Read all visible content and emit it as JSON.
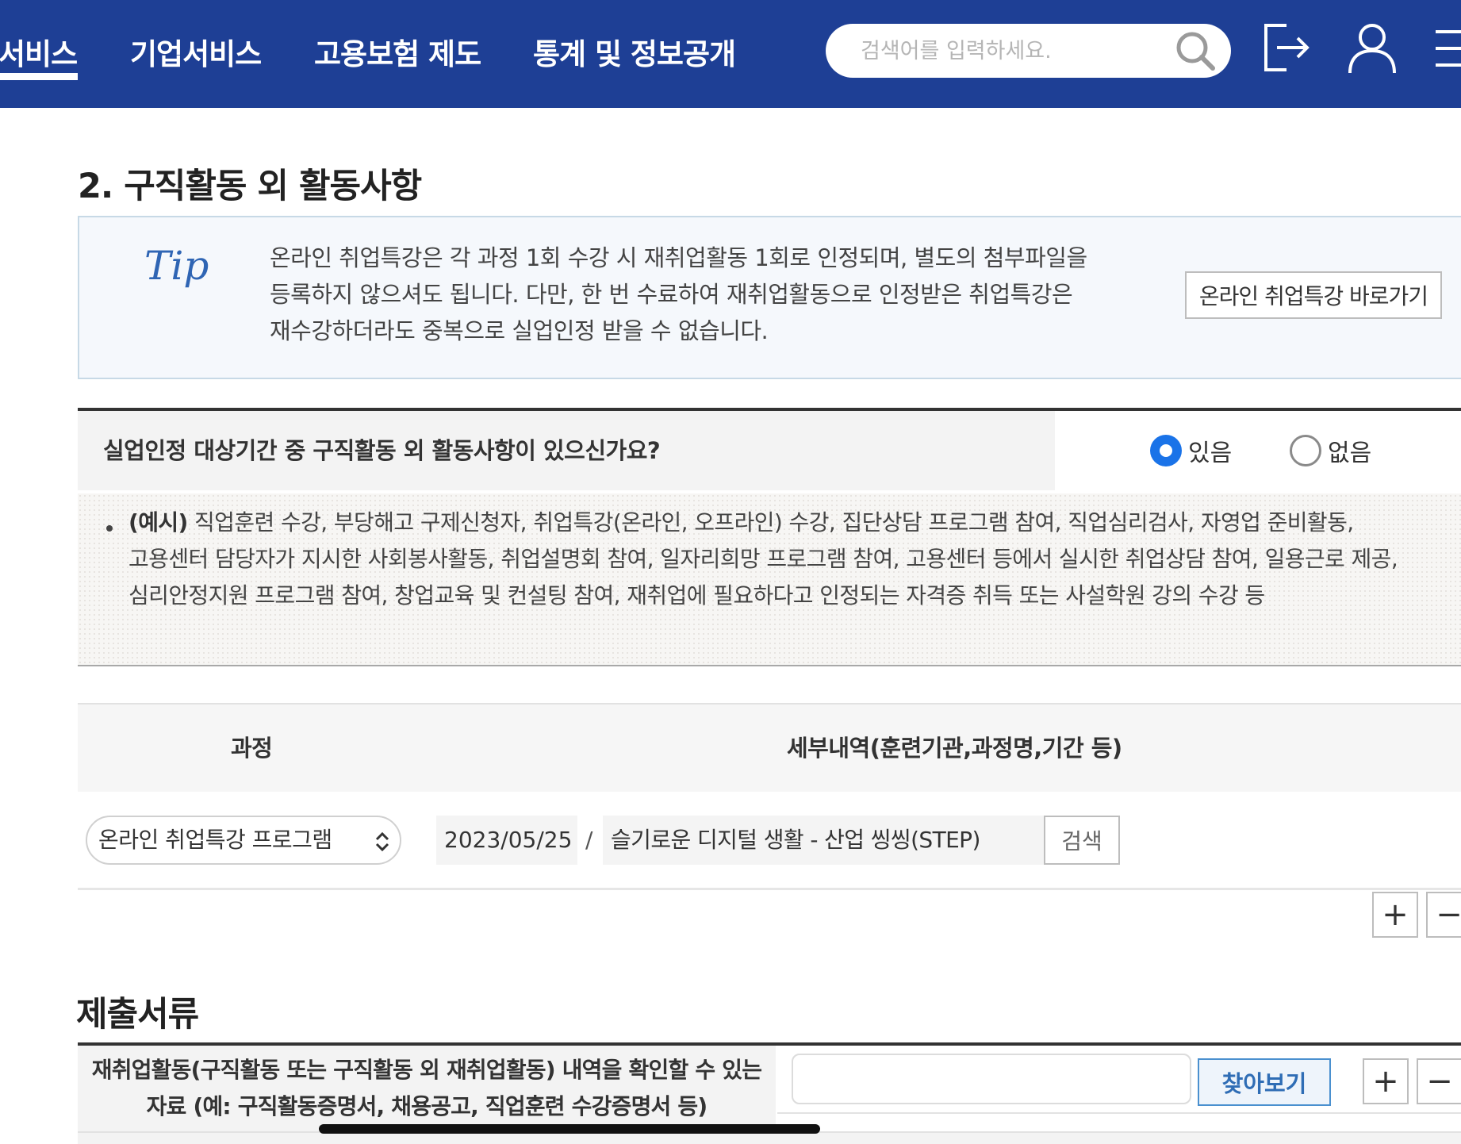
{
  "header": {
    "nav": [
      "서비스",
      "기업서비스",
      "고용보험 제도",
      "통계 및 정보공개"
    ],
    "active_nav": "서비스",
    "search_placeholder": "검색어를 입력하세요.",
    "colors": {
      "header_bg": "#1e3f95",
      "accent": "#1a73e8"
    },
    "icons": [
      "search-icon",
      "logout-icon",
      "user-icon",
      "menu-icon"
    ]
  },
  "section2": {
    "title": "2. 구직활동 외 활동사항",
    "tip": {
      "logo": "Tip",
      "lines": [
        "온라인 취업특강은 각 과정 1회 수강 시 재취업활동 1회로 인정되며, 별도의 첨부파일을",
        "등록하지 않으셔도 됩니다. 다만, 한 번 수료하여 재취업활동으로 인정받은 취업특강은",
        "재수강하더라도 중복으로 실업인정 받을 수 없습니다."
      ],
      "button_label": "온라인 취업특강 바로가기"
    },
    "question": {
      "label": "실업인정 대상기간 중 구직활동 외 활동사항이 있으신가요?",
      "options": [
        {
          "label": "있음",
          "selected": true
        },
        {
          "label": "없음",
          "selected": false
        }
      ]
    },
    "example": {
      "prefix": "(예시)",
      "lines": [
        " 직업훈련 수강, 부당해고 구제신청자, 취업특강(온라인, 오프라인) 수강, 집단상담 프로그램 참여, 직업심리검사, 자영업 준비활동,",
        "고용센터 담당자가 지시한 사회봉사활동, 취업설명회 참여, 일자리희망 프로그램 참여, 고용센터 등에서 실시한 취업상담 참여, 일용근로 제공,",
        "심리안정지원 프로그램 참여, 창업교육 및 컨설팅 참여, 재취업에 필요하다고 인정되는 자격증 취득 또는 사설학원 강의 수강 등"
      ]
    },
    "table": {
      "headers": [
        "과정",
        "세부내역(훈련기관,과정명,기간 등)"
      ],
      "row": {
        "course": "온라인 취업특강 프로그램",
        "date": "2023/05/25",
        "separator": "/",
        "detail": "슬기로운 디지털 생활 - 산업 씽씽(STEP)",
        "search_label": "검색"
      },
      "add_label": "+",
      "remove_label": "−"
    }
  },
  "documents": {
    "title": "제출서류",
    "label_lines": [
      "재취업활동(구직활동 또는 구직활동 외 재취업활동) 내역을 확인할 수 있는",
      "자료 (예: 구직활동증명서, 채용공고, 직업훈련 수강증명서 등)"
    ],
    "file_value": "",
    "browse_label": "찾아보기",
    "add_label": "+",
    "remove_label": "−"
  }
}
